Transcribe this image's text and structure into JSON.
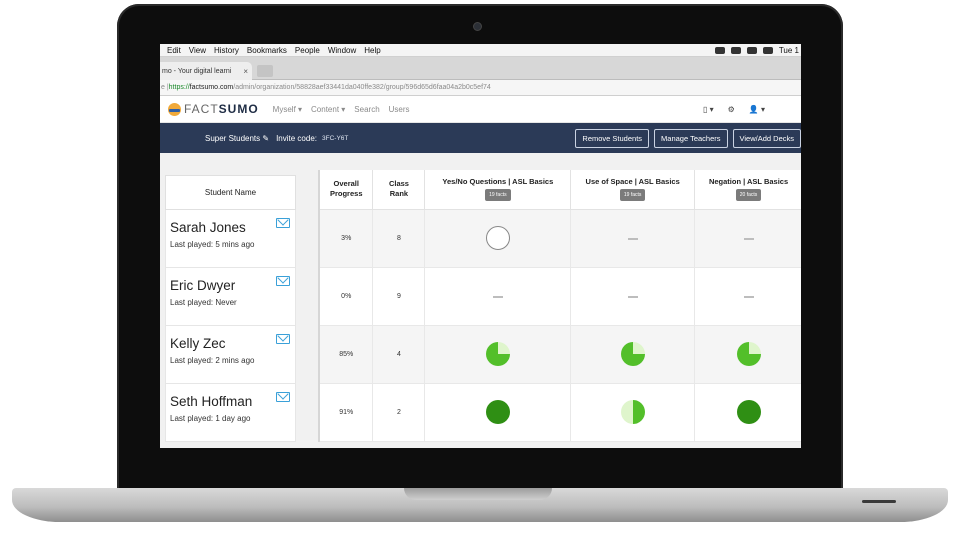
{
  "menubar": {
    "items": [
      "Edit",
      "View",
      "History",
      "Bookmarks",
      "People",
      "Window",
      "Help"
    ],
    "clock": "Tue 1"
  },
  "browser": {
    "tab_title": "mo - Your digital learni",
    "tab_close": "×",
    "url_prefix": "e | ",
    "url_scheme": "https://",
    "url_host": "factsumo.com",
    "url_path": "/admin/organization/58828aef33441da040ffe382/group/596d65d6faa04a2b0c5ef74"
  },
  "site": {
    "logo_fact": "FACT",
    "logo_sumo": "SUMO",
    "nav": [
      "Myself ▾",
      "Content ▾",
      "Search",
      "Users"
    ],
    "right_icons": [
      "▯ ▾",
      "⚙",
      "👤 ▾"
    ]
  },
  "classbar": {
    "group_name": "Super Students ✎",
    "invite_label": "Invite code:",
    "invite_code": "3FC-Y6T",
    "buttons": [
      "Remove Students",
      "Manage Teachers",
      "View/Add Decks"
    ]
  },
  "students": {
    "header": "Student Name",
    "list": [
      {
        "name": "Sarah Jones",
        "last_played": "Last played: 5 mins ago"
      },
      {
        "name": "Eric Dwyer",
        "last_played": "Last played: Never"
      },
      {
        "name": "Kelly Zec",
        "last_played": "Last played: 2 mins ago"
      },
      {
        "name": "Seth Hoffman",
        "last_played": "Last played: 1 day  ago"
      }
    ]
  },
  "grid": {
    "col_progress": [
      "Overall",
      "Progress"
    ],
    "col_rank": [
      "Class",
      "Rank"
    ],
    "decks": [
      {
        "title": "Yes/No Questions | ASL Basics",
        "facts": "19 facts"
      },
      {
        "title": "Use of Space | ASL Basics",
        "facts": "19 facts"
      },
      {
        "title": "Negation | ASL Basics",
        "facts": "20 facts"
      }
    ],
    "rows": [
      {
        "progress": "3%",
        "rank": "8",
        "cells": [
          "empty",
          "dash",
          "dash"
        ]
      },
      {
        "progress": "0%",
        "rank": "9",
        "cells": [
          "dash",
          "dash",
          "dash"
        ]
      },
      {
        "progress": "85%",
        "rank": "4",
        "cells": [
          "q",
          "q",
          "q"
        ]
      },
      {
        "progress": "91%",
        "rank": "2",
        "cells": [
          "full",
          "half",
          "full"
        ]
      }
    ]
  }
}
